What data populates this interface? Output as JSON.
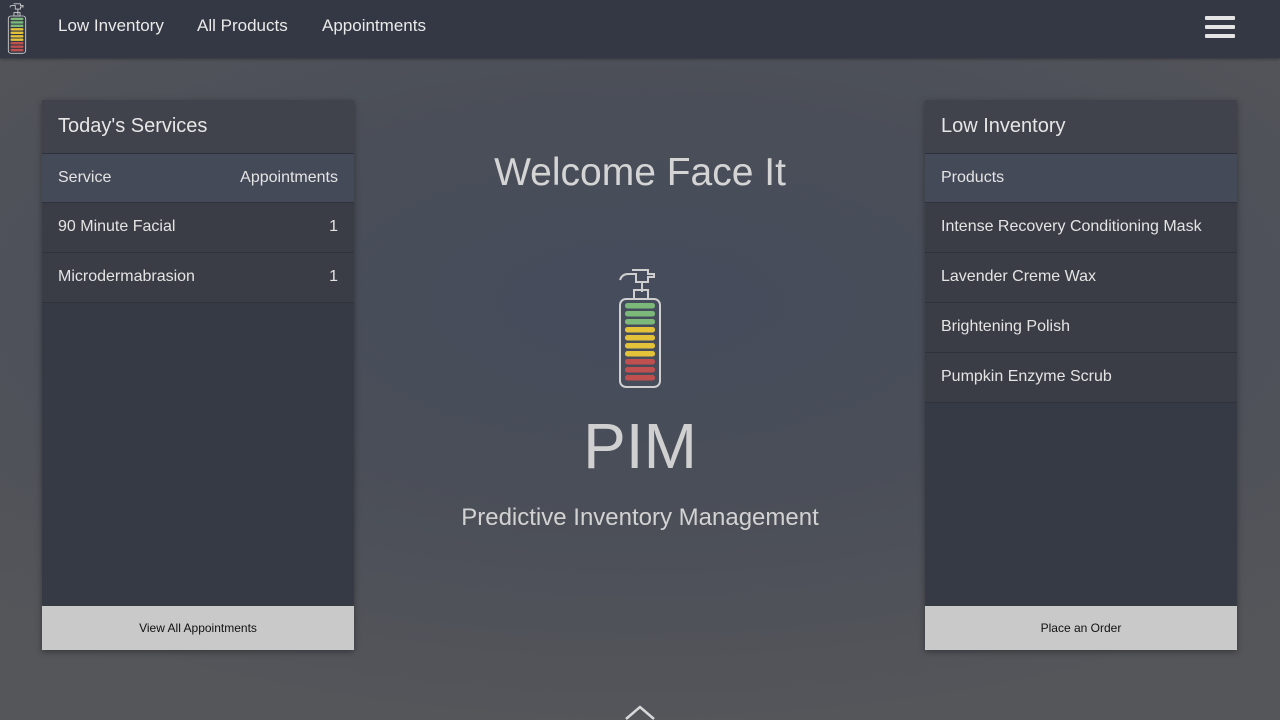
{
  "nav": {
    "links": [
      {
        "label": "Low Inventory"
      },
      {
        "label": "All Products"
      },
      {
        "label": "Appointments"
      }
    ],
    "menu_icon": "hamburger-menu-icon"
  },
  "services_panel": {
    "title": "Today's Services",
    "columns": [
      "Service",
      "Appointments"
    ],
    "rows": [
      {
        "service": "90 Minute Facial",
        "appointments": "1"
      },
      {
        "service": "Microdermabrasion",
        "appointments": "1"
      }
    ],
    "button_label": "View All Appointments"
  },
  "center": {
    "welcome": "Welcome Face It",
    "logo_icon": "pump-bottle-level-icon",
    "app_name": "PIM",
    "tagline": "Predictive Inventory Management"
  },
  "inventory_panel": {
    "title": "Low Inventory",
    "column": "Products",
    "products": [
      "Intense Recovery Conditioning Mask",
      "Lavender Creme Wax",
      "Brightening Polish",
      "Pumpkin Enzyme Scrub"
    ],
    "button_label": "Place an Order"
  },
  "scroll_icon": "chevron-up-icon",
  "colors": {
    "level_high": "#7cb87a",
    "level_mid": "#e3c23a",
    "level_low": "#c0504f",
    "topbar": "#333844",
    "button": "#c9c9c9"
  }
}
